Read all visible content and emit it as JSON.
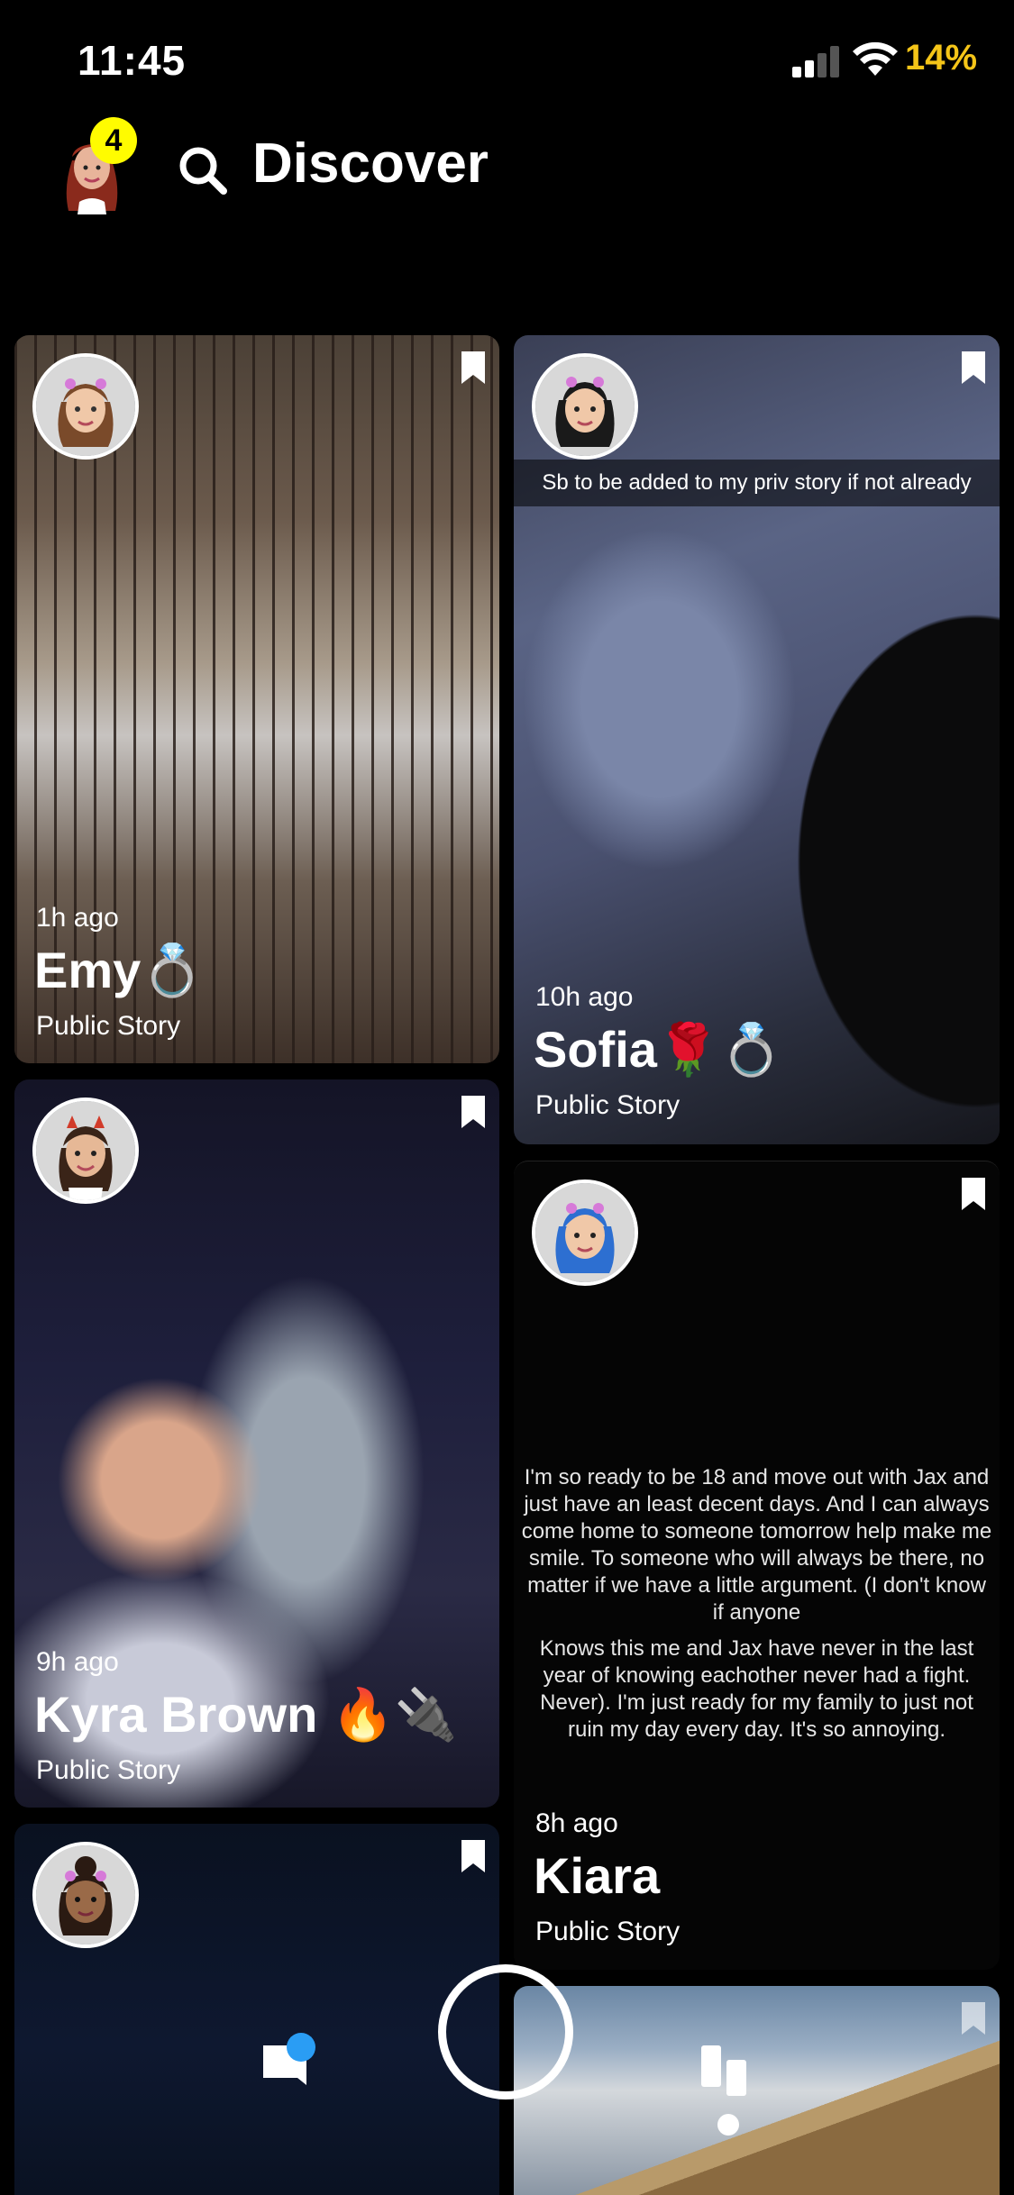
{
  "status": {
    "time": "11:45",
    "battery": "14%"
  },
  "header": {
    "title": "Discover",
    "notification_count": "4"
  },
  "stories": [
    {
      "time_ago": "1h ago",
      "name": "Emy💍",
      "type": "Public Story"
    },
    {
      "time_ago": "10h ago",
      "name": "Sofia🌹💍",
      "type": "Public Story",
      "caption": "Sb to be added to my priv story if not already"
    },
    {
      "time_ago": "9h ago",
      "name": "Kyra Brown 🔥🔌",
      "type": "Public Story"
    },
    {
      "time_ago": "8h ago",
      "name": "Kiara",
      "type": "Public Story",
      "text_p1": "I'm so ready to be 18 and move out with Jax and just have an least decent days. And I can always come home to someone tomorrow help make me smile. To someone who will always be there, no matter if we have a little argument. (I don't know if anyone",
      "text_p2": "Knows this me and Jax have never in the last year of knowing eachother never had a fight. Never). I'm just ready for my family to just not ruin my day every day. It's so annoying."
    }
  ],
  "icons": [
    "search-icon",
    "bookmark-icon",
    "chat-icon",
    "discover-icon",
    "wifi-icon",
    "signal-icon"
  ],
  "colors": {
    "accent_yellow": "#fffc00",
    "battery_yellow": "#f5c518",
    "chat_blue": "#2a9df4",
    "background": "#000000"
  }
}
